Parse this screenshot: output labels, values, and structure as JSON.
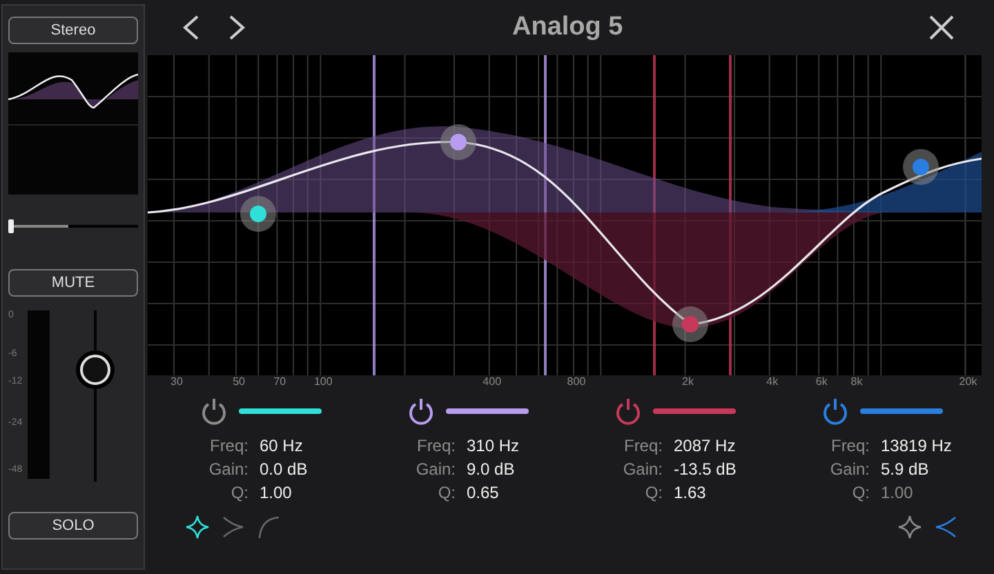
{
  "sidebar": {
    "stereo_button": "Stereo",
    "pan": {
      "level": 0.0
    },
    "mute_button": "MUTE",
    "meter_scale": [
      "0",
      "-6",
      "-12",
      "-24",
      "-48"
    ],
    "fader": {
      "level": 0.68
    },
    "solo_button": "SOLO"
  },
  "header": {
    "title": "Analog 5"
  },
  "freq_axis": [
    "30",
    "50",
    "70",
    "100",
    "400",
    "800",
    "2k",
    "4k",
    "6k",
    "8k",
    "20k"
  ],
  "bands": [
    {
      "color": "#2ee0d8",
      "on": false,
      "freq_label": "Freq:",
      "freq": "60 Hz",
      "gain_label": "Gain:",
      "gain": "0.0 dB",
      "q_label": "Q:",
      "q": "1.00",
      "q_disabled": false,
      "shapes": [
        {
          "kind": "bell",
          "selected": true
        },
        {
          "kind": "cut",
          "selected": false
        },
        {
          "kind": "shelf",
          "selected": false
        }
      ]
    },
    {
      "color": "#b79cf0",
      "on": true,
      "freq_label": "Freq:",
      "freq": "310 Hz",
      "gain_label": "Gain:",
      "gain": "9.0 dB",
      "q_label": "Q:",
      "q": "0.65",
      "q_disabled": false
    },
    {
      "color": "#c8385a",
      "on": true,
      "freq_label": "Freq:",
      "freq": "2087 Hz",
      "gain_label": "Gain:",
      "gain": "-13.5 dB",
      "q_label": "Q:",
      "q": "1.63",
      "q_disabled": false
    },
    {
      "color": "#2a7ee0",
      "on": true,
      "freq_label": "Freq:",
      "freq": "13819 Hz",
      "gain_label": "Gain:",
      "gain": "5.9 dB",
      "q_label": "Q:",
      "q": "1.00",
      "q_disabled": true,
      "shapes": [
        {
          "kind": "bell",
          "selected": false
        },
        {
          "kind": "shelf-left",
          "selected": true
        }
      ]
    }
  ]
}
